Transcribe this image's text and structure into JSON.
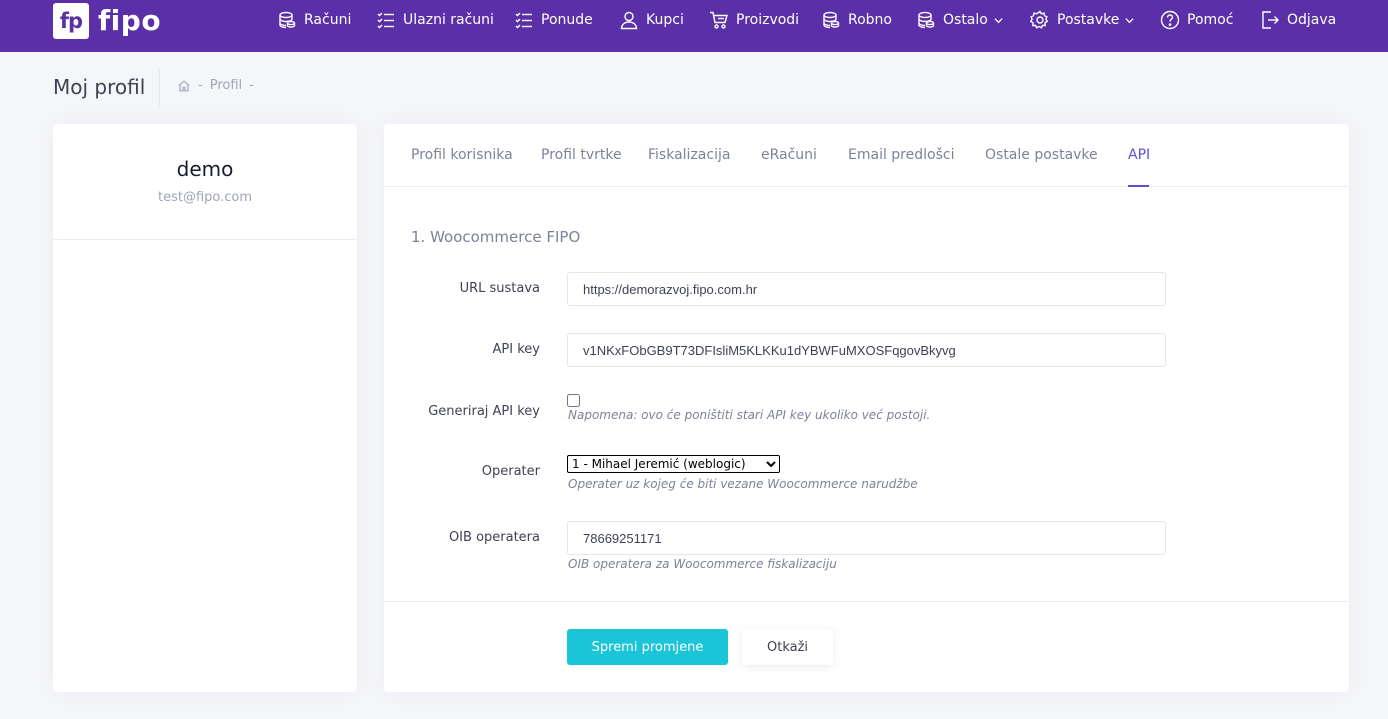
{
  "app": {
    "logo_mark": "fp",
    "logo_text": "fipo"
  },
  "nav": [
    {
      "label": "Računi",
      "icon": "coins-icon"
    },
    {
      "label": "Ulazni računi",
      "icon": "checklist-icon"
    },
    {
      "label": "Ponude",
      "icon": "checklist-icon"
    },
    {
      "label": "Kupci",
      "icon": "user-icon"
    },
    {
      "label": "Proizvodi",
      "icon": "cart-icon"
    },
    {
      "label": "Robno",
      "icon": "coins-icon"
    },
    {
      "label": "Ostalo",
      "icon": "coins-icon"
    },
    {
      "label": "Postavke",
      "icon": "gear-icon"
    },
    {
      "label": "Pomoć",
      "icon": "help-icon"
    },
    {
      "label": "Odjava",
      "icon": "logout-icon"
    }
  ],
  "header": {
    "title": "Moj profil",
    "breadcrumb": {
      "sep": "-",
      "item": "Profil"
    }
  },
  "profile": {
    "name": "demo",
    "email": "test@fipo.com"
  },
  "tabs": [
    {
      "label": "Profil korisnika"
    },
    {
      "label": "Profil tvrtke"
    },
    {
      "label": "Fiskalizacija"
    },
    {
      "label": "eRačuni"
    },
    {
      "label": "Email predlošci"
    },
    {
      "label": "Ostale postavke"
    },
    {
      "label": "API",
      "active": true
    }
  ],
  "form": {
    "section_title": "1. Woocommerce FIPO",
    "url": {
      "label": "URL sustava",
      "value": "https://demorazvoj.fipo.com.hr"
    },
    "api_key": {
      "label": "API key",
      "value": "v1NKxFObGB9T73DFIsliM5KLKKu1dYBWFuMXOSFqgovBkyvg"
    },
    "generate": {
      "label": "Generiraj API key",
      "hint": "Napomena: ovo će poništiti stari API key ukoliko već postoji."
    },
    "operater": {
      "label": "Operater",
      "selected": "1 - Mihael Jeremić (weblogic)",
      "hint": "Operater uz kojeg će biti vezane Woocommerce narudžbe"
    },
    "oib": {
      "label": "OIB operatera",
      "value": "78669251171",
      "hint": "OIB operatera za Woocommerce fiskalizaciju"
    }
  },
  "buttons": {
    "save": "Spremi promjene",
    "cancel": "Otkaži"
  },
  "colors": {
    "nav_bg": "#5b2fa8",
    "accent": "#5b50d6",
    "save_button": "#1bc5d8"
  }
}
